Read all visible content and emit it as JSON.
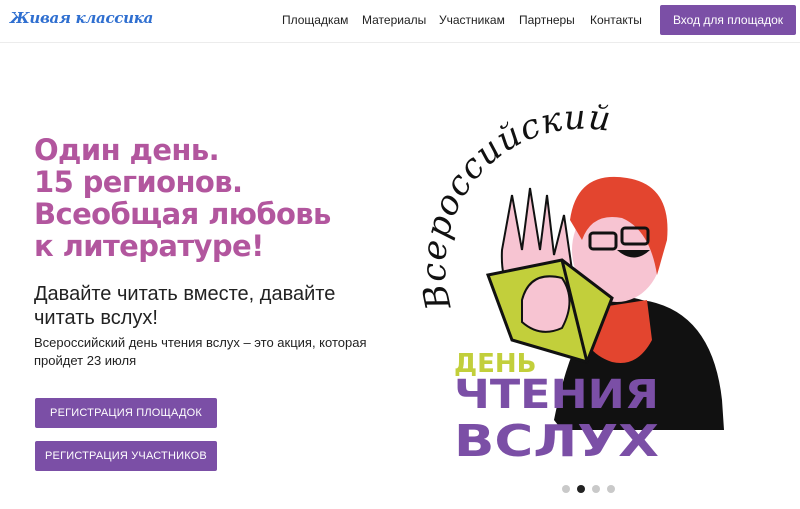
{
  "header": {
    "logo_text": "Живая классика",
    "nav": [
      {
        "label": "Площадкам"
      },
      {
        "label": "Материалы"
      },
      {
        "label": "Участникам"
      },
      {
        "label": "Партнеры"
      },
      {
        "label": "Контакты"
      }
    ],
    "login_label": "Вход для площадок"
  },
  "hero": {
    "heading_lines": [
      "Один день.",
      "15 регионов.",
      "Всеобщая любовь",
      "к литературе!"
    ],
    "subheading": "Давайте читать вместе, давайте читать вслух!",
    "description": "Всероссийский день чтения вслух – это акция, которая пройдет 23 июля",
    "buttons": {
      "register_venues": "РЕГИСТРАЦИЯ ПЛОЩАДОК",
      "register_participants": "РЕГИСТРАЦИЯ УЧАСТНИКОВ"
    }
  },
  "poster": {
    "arc_text": "Всероссийский",
    "line_day": "ДЕНЬ",
    "line_reading": "ЧТЕНИЯ",
    "line_aloud": "ВСЛУХ"
  },
  "carousel": {
    "slide_count": 4,
    "active_index": 1
  },
  "colors": {
    "accent_purple": "#7b4fa6",
    "heading_pink": "#b2569e",
    "poster_lime": "#c2cf3b",
    "poster_red_hair": "#e3452f",
    "logo_blue": "#2f6fd0"
  }
}
